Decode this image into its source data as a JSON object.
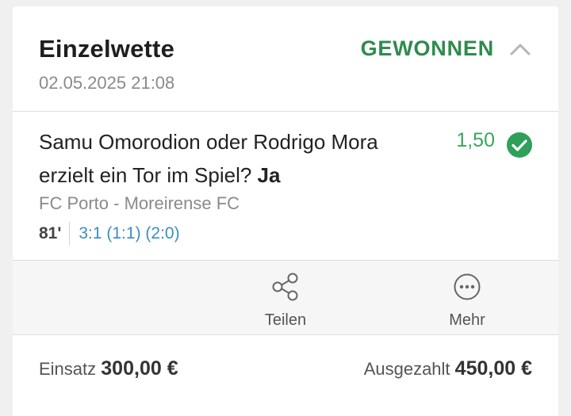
{
  "header": {
    "title": "Einzelwette",
    "datetime": "02.05.2025 21:08",
    "status": "GEWONNEN"
  },
  "bet": {
    "selection_text": "Samu Omorodion oder Rodrigo Mora erzielt ein Tor im Spiel?",
    "selection_answer": "Ja",
    "odds": "1,50",
    "match": "FC Porto - Moreirense FC",
    "minute": "81'",
    "score": "3:1 (1:1) (2:0)"
  },
  "actions": {
    "share_label": "Teilen",
    "more_label": "Mehr"
  },
  "footer": {
    "stake_label": "Einsatz",
    "stake_amount": "300,00 €",
    "payout_label": "Ausgezahlt",
    "payout_amount": "450,00 €"
  },
  "colors": {
    "won_green": "#2e8b4e",
    "odds_green": "#3aa65a",
    "check_green": "#2fa05a",
    "score_blue": "#3a8fbf"
  },
  "icons": [
    "chevron-up-icon",
    "check-circle-icon",
    "share-icon",
    "more-icon"
  ]
}
